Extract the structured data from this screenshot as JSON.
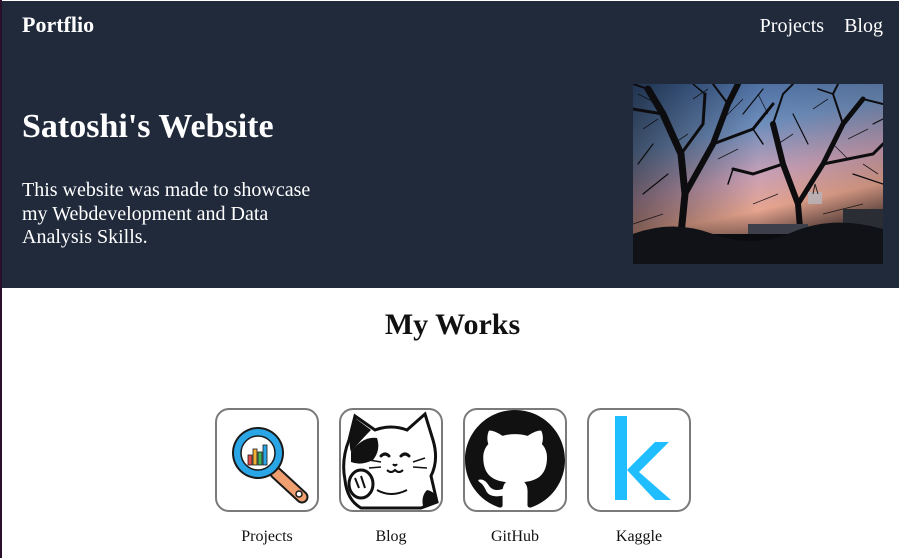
{
  "nav": {
    "brand": "Portflio",
    "links": [
      "Projects",
      "Blog"
    ]
  },
  "hero": {
    "title": "Satoshi's Website",
    "description": "This website was made to showcase my Webdevelopment and Data Analysis Skills."
  },
  "works": {
    "title": "My Works",
    "items": [
      {
        "label": "Projects",
        "icon": "magnifier-chart-icon"
      },
      {
        "label": "Blog",
        "icon": "lucky-cat-icon"
      },
      {
        "label": "GitHub",
        "icon": "github-octocat-icon"
      },
      {
        "label": "Kaggle",
        "icon": "kaggle-k-icon"
      }
    ]
  },
  "colors": {
    "hero_background": "#202a3b",
    "text_light": "#ffffff",
    "tile_border": "#7a7a7a",
    "kaggle_blue": "#20beff"
  }
}
